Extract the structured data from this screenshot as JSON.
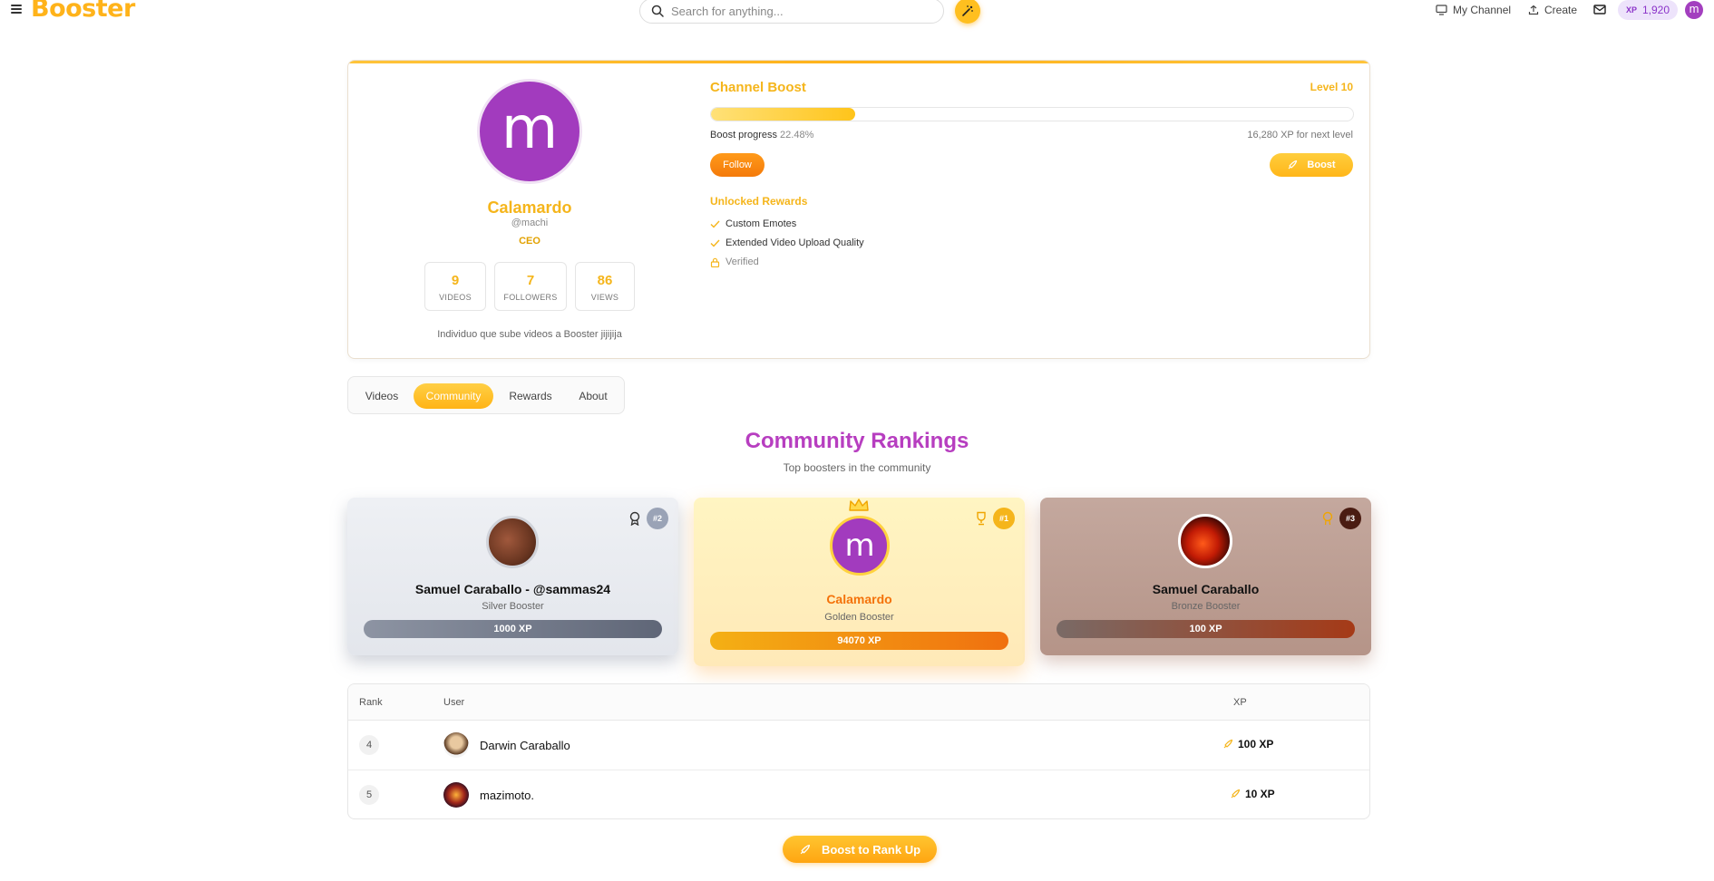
{
  "header": {
    "logo": "Booster",
    "search_placeholder": "Search for anything...",
    "my_channel": "My Channel",
    "create": "Create",
    "xp_label": "XP",
    "xp_value": "1,920",
    "avatar_letter": "m"
  },
  "profile": {
    "avatar_letter": "m",
    "name": "Calamardo",
    "handle": "@machi",
    "role": "CEO",
    "stats": [
      {
        "value": "9",
        "label": "VIDEOS"
      },
      {
        "value": "7",
        "label": "FOLLOWERS"
      },
      {
        "value": "86",
        "label": "VIEWS"
      }
    ],
    "bio": "Individuo que sube videos a Booster jijijija"
  },
  "boost": {
    "title": "Channel Boost",
    "level": "Level 10",
    "progress_label": "Boost progress",
    "progress_value": "22.48%",
    "progress_fraction": 0.2248,
    "next_level": "16,280 XP for next level",
    "follow_label": "Follow",
    "boost_label": "Boost",
    "unlocked_title": "Unlocked Rewards",
    "rewards": [
      {
        "label": "Custom Emotes",
        "unlocked": true
      },
      {
        "label": "Extended Video Upload Quality",
        "unlocked": true
      },
      {
        "label": "Verified",
        "unlocked": false
      }
    ]
  },
  "tabs": [
    {
      "label": "Videos",
      "active": false
    },
    {
      "label": "Community",
      "active": true
    },
    {
      "label": "Rewards",
      "active": false
    },
    {
      "label": "About",
      "active": false
    }
  ],
  "rankings": {
    "title": "Community Rankings",
    "subtitle": "Top boosters in the community",
    "podium": [
      {
        "rank": "#2",
        "name": "Samuel Caraballo - @sammas24",
        "tier": "Silver Booster",
        "xp": "1000 XP"
      },
      {
        "rank": "#1",
        "name": "Calamardo",
        "tier": "Golden Booster",
        "xp": "94070 XP",
        "avatar_letter": "m"
      },
      {
        "rank": "#3",
        "name": "Samuel Caraballo",
        "tier": "Bronze Booster",
        "xp": "100 XP"
      }
    ],
    "table": {
      "headers": [
        "Rank",
        "User",
        "XP"
      ],
      "rows": [
        {
          "rank": "4",
          "user": "Darwin Caraballo",
          "xp": "100 XP"
        },
        {
          "rank": "5",
          "user": "mazimoto.",
          "xp": "10 XP"
        }
      ]
    },
    "cta": "Boost to Rank Up"
  },
  "colors": {
    "accent": "#f5b51b",
    "purple": "#b73ec0",
    "orange": "#f47a0a"
  }
}
